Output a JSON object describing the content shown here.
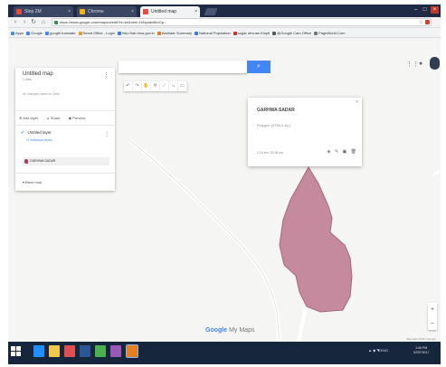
{
  "browser": {
    "tabs": [
      {
        "label": "Step 2M",
        "color": "#e54c3c"
      },
      {
        "label": "Chrome",
        "color": "#f0b400"
      },
      {
        "label": "Untitled map",
        "color": "#e54c3c",
        "active": true
      }
    ],
    "url": "https://www.google.com/maps/d/edit?hl=en&mid=1kNyudc6ltoGp...",
    "bookmarks": [
      {
        "label": "Apps",
        "color": "#4a90d9"
      },
      {
        "label": "Google",
        "color": "#4285f4"
      },
      {
        "label": "google translate",
        "color": "#4285f4"
      },
      {
        "label": "Smart Office - Login",
        "color": "#e0a030"
      },
      {
        "label": "http://lab.hrsa.gov.in",
        "color": "#3b7fd4"
      },
      {
        "label": "Aadhaar Summary",
        "color": "#e07b2a"
      },
      {
        "label": "National Population",
        "color": "#3a7bd5"
      },
      {
        "label": "sugar devuan Klopfi",
        "color": "#d03030"
      },
      {
        "label": "@Google Cam Office",
        "color": "#5a5a5a"
      },
      {
        "label": "PageWorld.Com",
        "color": "#777777"
      }
    ]
  },
  "panel": {
    "title": "Untitled map",
    "subtitle": "1 view",
    "saved": "All changes saved in Drive",
    "actions": [
      "Add layer",
      "Share",
      "Preview"
    ],
    "layer_name": "Untitled layer",
    "layer_style": "Individual styles",
    "item": "GARHWA SADAR",
    "base_map": "Base map"
  },
  "card": {
    "title": "GARHWA SADAR",
    "description": "Polygon (4756.4 sq.)",
    "measurement": "2.19 km²  33.95 km"
  },
  "branding": {
    "google": "Google",
    "product": "My Maps"
  },
  "attribution": "Map data ©2017 Google",
  "taskbar": {
    "tray": "▲  ◆  ◥  ENG",
    "time": "1:06 PM",
    "date": "02/07/2017",
    "apps": [
      {
        "name": "ie",
        "color": "#1e90ff"
      },
      {
        "name": "explorer",
        "color": "#f2c94c"
      },
      {
        "name": "media",
        "color": "#e05050"
      },
      {
        "name": "word",
        "color": "#2b5797"
      },
      {
        "name": "chrome",
        "color": "#4caf50"
      },
      {
        "name": "app",
        "color": "#9b59b6"
      },
      {
        "name": "chrome-active",
        "color": "#e67e22"
      }
    ]
  },
  "map": {
    "polygon_color": "#c68a9e",
    "polygon_stroke": "#a4687c"
  }
}
